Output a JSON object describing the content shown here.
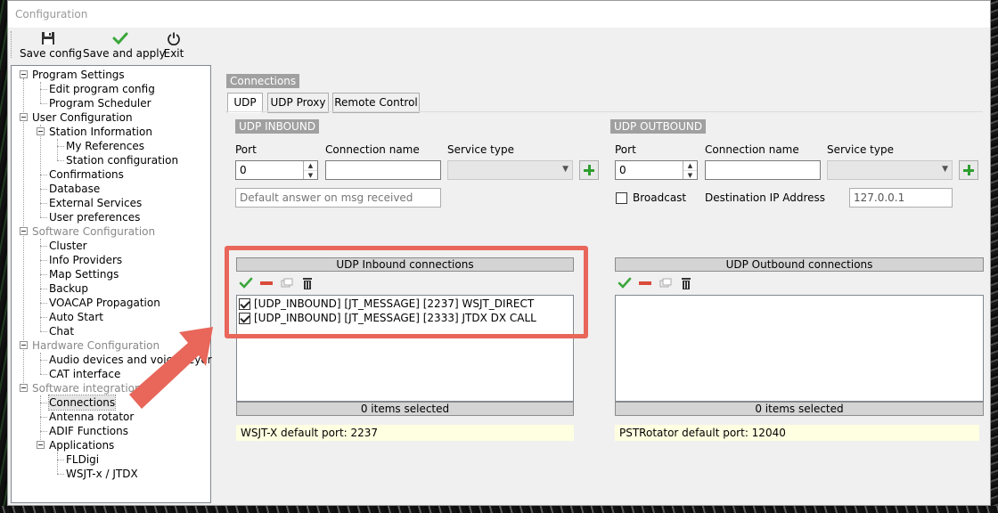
{
  "window": {
    "title": "Configuration"
  },
  "toolbar": {
    "save_config": "Save config",
    "save_apply": "Save and apply",
    "exit": "Exit"
  },
  "tree": {
    "program_settings": "Program Settings",
    "edit_program_config": "Edit program config",
    "program_scheduler": "Program Scheduler",
    "user_configuration": "User Configuration",
    "station_information": "Station Information",
    "my_references": "My References",
    "station_configuration": "Station configuration",
    "confirmations": "Confirmations",
    "database": "Database",
    "external_services": "External Services",
    "user_preferences": "User preferences",
    "software_configuration": "Software Configuration",
    "cluster": "Cluster",
    "info_providers": "Info Providers",
    "map_settings": "Map Settings",
    "backup": "Backup",
    "voacap": "VOACAP Propagation",
    "auto_start": "Auto Start",
    "chat": "Chat",
    "hardware_configuration": "Hardware Configuration",
    "audio_devices": "Audio devices and voice keyer",
    "cat_interface": "CAT interface",
    "software_integration": "Software integration",
    "connections": "Connections",
    "antenna_rotator": "Antenna rotator",
    "adif_functions": "ADIF Functions",
    "applications": "Applications",
    "fldigi": "FLDigi",
    "wsjt": "WSJT-x / JTDX"
  },
  "panel": {
    "group_title": "Connections",
    "tabs": [
      "UDP",
      "UDP Proxy",
      "Remote Control"
    ],
    "inbound": {
      "title": "UDP INBOUND",
      "port_label": "Port",
      "port_value": "0",
      "conn_name_label": "Connection name",
      "service_type_label": "Service type",
      "default_answer_placeholder": "Default answer on msg received",
      "list_title": "UDP Inbound connections",
      "items": [
        "[UDP_INBOUND] [JT_MESSAGE] [2237] WSJT_DIRECT",
        "[UDP_INBOUND] [JT_MESSAGE] [2333] JTDX DX CALL"
      ],
      "footer": "0 items selected",
      "hint": "WSJT-X default port: 2237"
    },
    "outbound": {
      "title": "UDP OUTBOUND",
      "port_label": "Port",
      "port_value": "0",
      "conn_name_label": "Connection name",
      "service_type_label": "Service type",
      "broadcast_label": "Broadcast",
      "dest_ip_label": "Destination IP Address",
      "dest_ip_value": "127.0.0.1",
      "list_title": "UDP Outbound connections",
      "footer": "0 items selected",
      "hint": "PSTRotator default port: 12040"
    }
  },
  "colors": {
    "accent_highlight": "#e8665a",
    "group_label_bg": "#a0a0a0",
    "hint_bg": "#ffffe1"
  }
}
